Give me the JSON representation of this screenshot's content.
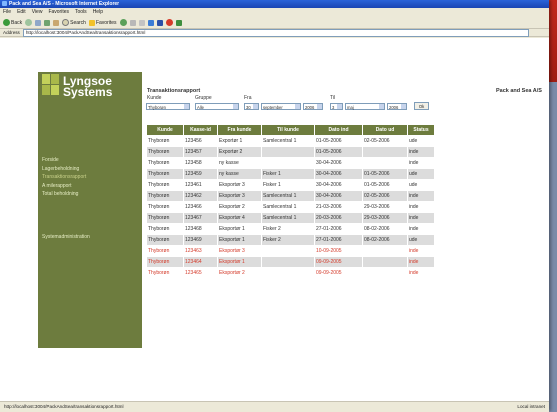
{
  "window": {
    "title": "Pack and Sea A/S - Microsoft Internet Explorer"
  },
  "menu": [
    "File",
    "Edit",
    "View",
    "Favorites",
    "Tools",
    "Help"
  ],
  "toolbar": {
    "back": "Back",
    "search": "Search",
    "favorites": "Favorites"
  },
  "address": {
    "label": "Address",
    "url": "http://localhost:3004/PackAndSea/transaktionsrapport.html"
  },
  "logo": {
    "line1": "Lyngsoe",
    "line2": "Systems"
  },
  "nav": {
    "links": [
      "Forside",
      "Lagerbeholdning",
      "Transaktionsrapport",
      "A milerapport",
      "Total beholdning"
    ],
    "admin": "Systemadministration"
  },
  "page": {
    "title": "Transaktionsrapport",
    "company": "Pack and Sea A/S"
  },
  "filters": {
    "labels": {
      "kunde": "Kunde",
      "gruppe": "Gruppe",
      "fra": "Fra",
      "til": "Til"
    },
    "kunde_value": "Thyborøn",
    "gruppe_value": "Alle",
    "fra_day": "30",
    "fra_month": "september",
    "fra_year": "2006",
    "til_day": "3",
    "til_month": "maj",
    "til_year": "2006",
    "ok": "Ok"
  },
  "table": {
    "headers": [
      "Kunde",
      "Kasse-id",
      "Fra kunde",
      "Til kunde",
      "Dato ind",
      "Dato ud",
      "Status"
    ],
    "rows": [
      {
        "c": [
          "Thyborøn",
          "123456",
          "Exportør 1",
          "Samlecentral 1",
          "01-05-2006",
          "02-05-2006",
          "ude"
        ],
        "shade": false,
        "red": false
      },
      {
        "c": [
          "Thyborøn",
          "123457",
          "Exportør 2",
          "",
          "01-05-2006",
          "",
          "inde"
        ],
        "shade": true,
        "red": false
      },
      {
        "c": [
          "Thyborøn",
          "123458",
          "ny kasse",
          "",
          "30-04-2006",
          "",
          "inde"
        ],
        "shade": false,
        "red": false
      },
      {
        "c": [
          "Thyborøn",
          "123459",
          "ny kasse",
          "Fisker 1",
          "30-04-2006",
          "01-05-2006",
          "ude"
        ],
        "shade": true,
        "red": false
      },
      {
        "c": [
          "Thyborøn",
          "123461",
          "Eksportør 3",
          "Fisker 1",
          "30-04-2006",
          "01-05-2006",
          "ude"
        ],
        "shade": false,
        "red": false
      },
      {
        "c": [
          "Thyborøn",
          "123462",
          "Eksportør 3",
          "Samlecentral 1",
          "30-04-2006",
          "02-05-2006",
          "inde"
        ],
        "shade": true,
        "red": false
      },
      {
        "c": [
          "Thyborøn",
          "123466",
          "Eksportør 2",
          "Samlecentral 1",
          "21-03-2006",
          "29-03-2006",
          "inde"
        ],
        "shade": false,
        "red": false
      },
      {
        "c": [
          "Thyborøn",
          "123467",
          "Eksportør 4",
          "Samlecentral 1",
          "20-03-2006",
          "29-03-2006",
          "inde"
        ],
        "shade": true,
        "red": false
      },
      {
        "c": [
          "Thyborøn",
          "123468",
          "Eksportør 1",
          "Fisker 2",
          "27-01-2006",
          "08-02-2006",
          "inde"
        ],
        "shade": false,
        "red": false
      },
      {
        "c": [
          "Thyborøn",
          "123469",
          "Eksportør 1",
          "Fisker 2",
          "27-01-2006",
          "08-02-2006",
          "ude"
        ],
        "shade": true,
        "red": false
      },
      {
        "c": [
          "Thyborøn",
          "123463",
          "Eksportør 3",
          "",
          "10-09-2005",
          "",
          "inde"
        ],
        "shade": false,
        "red": true
      },
      {
        "c": [
          "Thyborøn",
          "123464",
          "Eksportør 1",
          "",
          "09-09-2005",
          "",
          "inde"
        ],
        "shade": true,
        "red": true
      },
      {
        "c": [
          "Thyborøn",
          "123465",
          "Eksportør 2",
          "",
          "09-09-2005",
          "",
          "inde"
        ],
        "shade": false,
        "red": true
      }
    ]
  },
  "status": {
    "left": "http://localhost:3004/PackAndSea/transaktionsrapport.html",
    "right": "Local intranet"
  },
  "colors": {
    "nav_green": "#6d7c3e",
    "header_green": "#6d7c3e",
    "alert_red": "#d43a2a"
  }
}
